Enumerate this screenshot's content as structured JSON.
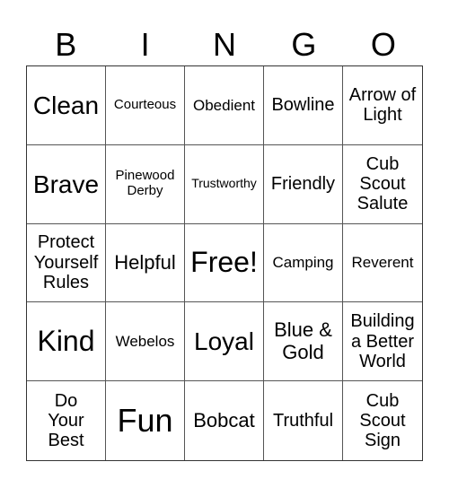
{
  "header": [
    "B",
    "I",
    "N",
    "G",
    "O"
  ],
  "cells": [
    "Clean",
    "Courteous",
    "Obedient",
    "Bowline",
    "Arrow of Light",
    "Brave",
    "Pinewood Derby",
    "Trustworthy",
    "Friendly",
    "Cub Scout Salute",
    "Protect Yourself Rules",
    "Helpful",
    "Free!",
    "Camping",
    "Reverent",
    "Kind",
    "Webelos",
    "Loyal",
    "Blue & Gold",
    "Building a Better World",
    "Do Your Best",
    "Fun",
    "Bobcat",
    "Truthful",
    "Cub Scout Sign"
  ]
}
